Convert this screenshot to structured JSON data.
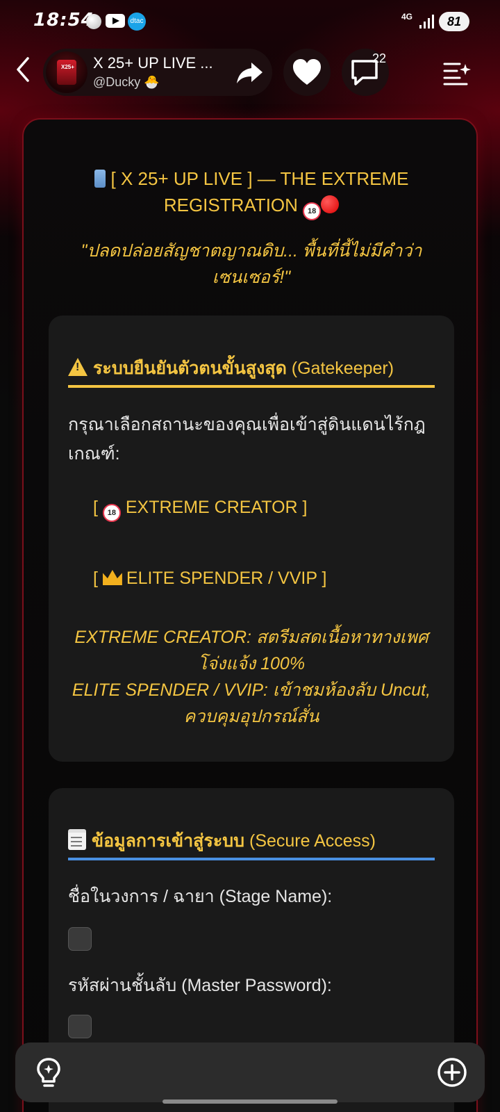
{
  "status_bar": {
    "time": "18:54",
    "carrier": "dtac",
    "network": "4G",
    "battery": "81"
  },
  "header": {
    "bot_title": "X 25+ UP LIVE ...",
    "bot_handle": "@Ducky 🐣",
    "comment_count": "22"
  },
  "card": {
    "title": "[ X 25+ UP LIVE ] — THE EXTREME REGISTRATION",
    "quote": "\"ปลดปล่อยสัญชาตญาณดิบ... พื้นที่นี้ไม่มีคำว่าเซนเซอร์!\""
  },
  "gatekeeper": {
    "heading_bold": "ระบบยืนยันตัวตนขั้นสูงสุด",
    "heading_rest": "(Gatekeeper)",
    "intro": "กรุณาเลือกสถานะของคุณเพื่อเข้าสู่ดินแดนไร้กฎเกณฑ์:",
    "option_creator": "EXTREME CREATOR ]",
    "option_creator_open": "[",
    "option_elite": "ELITE SPENDER / VVIP ]",
    "option_elite_open": "[",
    "desc_line1": "EXTREME CREATOR: สตรีมสดเนื้อหาทางเพศโจ่งแจ้ง 100%",
    "desc_line2": "ELITE SPENDER / VVIP: เข้าชมห้องลับ Uncut, ควบคุมอุปกรณ์สั่น"
  },
  "access": {
    "heading_bold": "ข้อมูลการเข้าสู่ระบบ",
    "heading_rest": "(Secure Access)",
    "stage_label": "ชื่อในวงการ / ฉายา (Stage Name):",
    "password_label": "รหัสผ่านชั้นลับ (Master Password):"
  },
  "icons": {
    "back": "chevron-left-icon",
    "share": "share-arrow-icon",
    "like": "heart-icon",
    "comment": "comment-bubble-icon",
    "menu": "playlist-menu-icon",
    "bulb": "lightbulb-icon",
    "plus": "plus-circle-icon"
  },
  "colors": {
    "accent_yellow": "#f4c542",
    "accent_blue": "#4a90e2",
    "border_red": "#7a0f1a"
  }
}
